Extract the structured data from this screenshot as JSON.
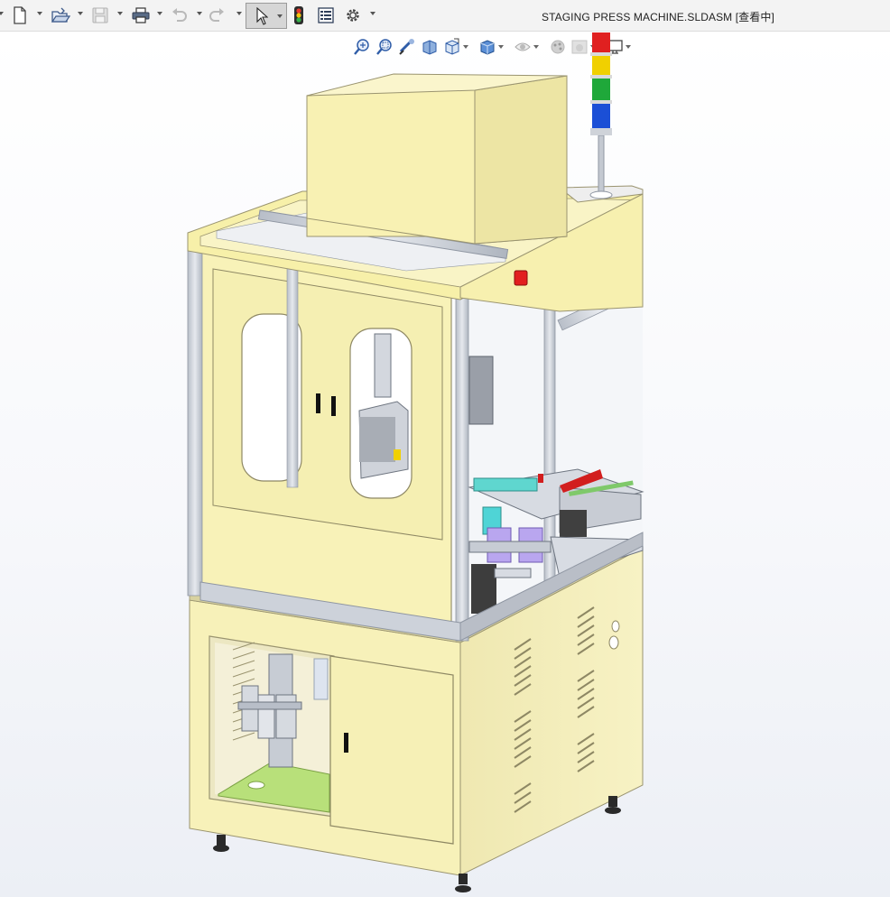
{
  "window": {
    "title": "STAGING PRESS MACHINE.SLDASM [查看中]"
  },
  "toolbar": {
    "items": [
      {
        "name": "new-document",
        "icon": "new-document-icon",
        "has_dropdown": true
      },
      {
        "name": "open",
        "icon": "open-folder-icon",
        "has_dropdown": true
      },
      {
        "name": "save",
        "icon": "save-icon",
        "has_dropdown": true,
        "disabled": true
      },
      {
        "name": "print",
        "icon": "print-icon",
        "has_dropdown": true
      },
      {
        "name": "undo",
        "icon": "undo-icon",
        "has_dropdown": true,
        "disabled": true
      },
      {
        "name": "redo",
        "icon": "redo-icon",
        "has_dropdown": true,
        "disabled": true
      },
      {
        "name": "select",
        "icon": "select-arrow-icon",
        "has_dropdown": true,
        "active": true
      },
      {
        "name": "rebuild",
        "icon": "traffic-light-icon",
        "has_dropdown": false
      },
      {
        "name": "file-properties",
        "icon": "file-properties-icon",
        "has_dropdown": false
      },
      {
        "name": "options",
        "icon": "gear-icon",
        "has_dropdown": true
      }
    ]
  },
  "view_toolbar": {
    "items": [
      "zoom-to-fit-icon",
      "zoom-to-area-icon",
      "previous-view-icon",
      "section-view-icon",
      "view-orientation-icon",
      "display-style-icon",
      "hide-show-items-icon",
      "edit-appearance-icon",
      "apply-scene-icon",
      "view-settings-icon"
    ]
  },
  "colors": {
    "accent": "#c8a200",
    "cabinet": "#f7f1b4",
    "cabinet_shade": "#e8e0a0",
    "frame": "#c9ced6",
    "viewport_bg": "#f6f7fa",
    "tower_red": "#e02020",
    "tower_yellow": "#f0d000",
    "tower_green": "#1fa83a",
    "tower_blue": "#1b4fd6"
  },
  "model": {
    "name": "STAGING PRESS MACHINE",
    "parts": [
      "upper-cover-box",
      "upper-cabinet",
      "lower-cabinet",
      "signal-tower",
      "aluminum-frame",
      "work-station",
      "air-filter-regulator",
      "leveling-feet"
    ]
  }
}
